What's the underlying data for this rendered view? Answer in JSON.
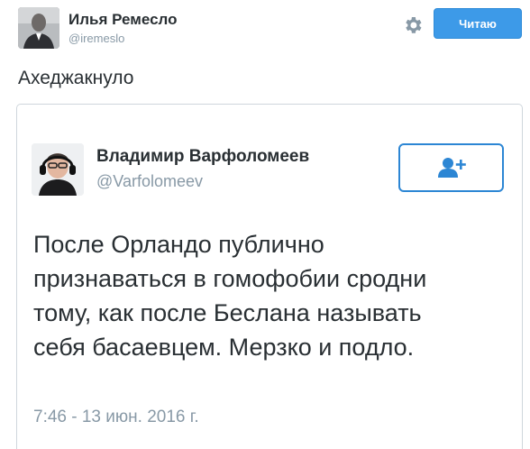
{
  "outer_tweet": {
    "author": {
      "display_name": "Илья Ремесло",
      "screen_name": "@iremeslo"
    },
    "follow_button_label": "Читаю",
    "settings_icon": "gear-icon",
    "text": "Ахеджакнуло"
  },
  "quoted_tweet": {
    "author": {
      "display_name": "Владимир Варфоломеев",
      "screen_name": "@Varfolomeev"
    },
    "follow_icon": "add-user-icon",
    "text_lines": [
      "После Орландо публично",
      "признаваться в гомофобии сродни",
      "тому, как после Беслана называть",
      "себя басаевцем. Мерзко и подло."
    ],
    "timestamp": "7:46 - 13 июн. 2016 г."
  },
  "colors": {
    "accent": "#3d9ae8",
    "secondary_text": "#8899a6",
    "primary_text": "#292f33",
    "card_border": "#cfd6dc"
  }
}
